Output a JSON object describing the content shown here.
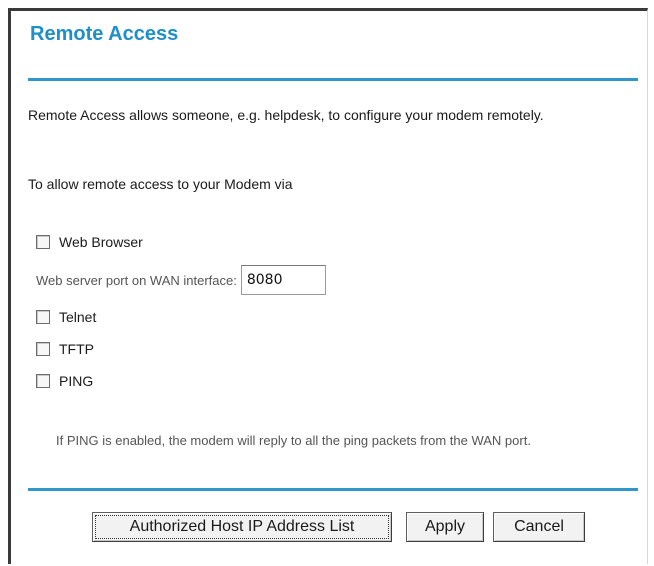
{
  "page": {
    "title": "Remote Access",
    "description": "Remote Access allows someone, e.g. helpdesk, to configure your modem remotely.",
    "via_label": "To allow remote access to your Modem via"
  },
  "options": {
    "web_browser": {
      "label": "Web Browser",
      "checked": false
    },
    "port_label": "Web server port on WAN interface:",
    "port_value": "8080",
    "telnet": {
      "label": "Telnet",
      "checked": false
    },
    "tftp": {
      "label": "TFTP",
      "checked": false
    },
    "ping": {
      "label": "PING",
      "checked": false
    }
  },
  "note": "If PING is enabled, the modem will reply to all the ping packets from the WAN port.",
  "buttons": {
    "authorized_hosts": "Authorized Host IP Address List",
    "apply": "Apply",
    "cancel": "Cancel"
  },
  "colors": {
    "title": "#1e8fc9",
    "rule": "#2f97cc"
  }
}
